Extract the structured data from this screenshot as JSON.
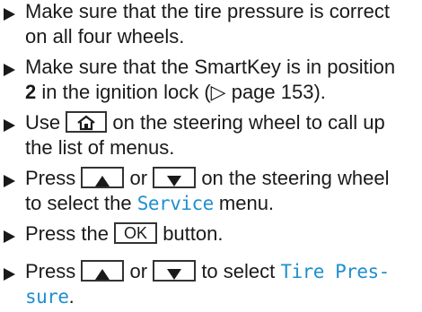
{
  "steps": [
    {
      "lines": [
        "Make sure that the tire pressure is correct",
        "on all four wheels."
      ]
    },
    {
      "line1": "Make sure that the SmartKey is in position",
      "pos": "2",
      "line2_rest": " in the ignition lock (▷ page 153)."
    },
    {
      "pre": "Use",
      "post": "on the steering wheel to call up",
      "line2": "the list of menus."
    },
    {
      "pre": "Press",
      "or": "or",
      "post": "on the steering wheel",
      "line2_pre": "to select the",
      "menu": "Service",
      "line2_post": " menu."
    },
    {
      "pre": "Press the",
      "ok": "OK",
      "post": "button."
    },
    {
      "pre": "Press",
      "or": "or",
      "post": "to select",
      "menu1": "Tire Pres-",
      "menu2": "sure",
      "end": "."
    }
  ],
  "icons": [
    "triangle-bullet-icon",
    "home-icon",
    "up-arrow-icon",
    "down-arrow-icon"
  ]
}
